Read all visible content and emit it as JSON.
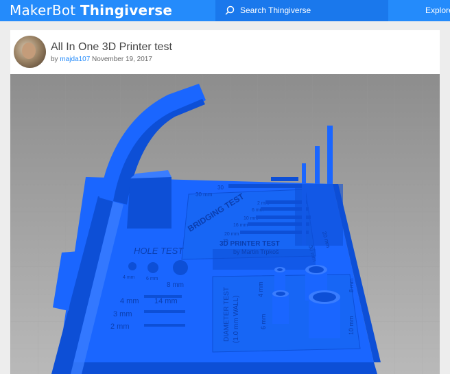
{
  "header": {
    "logo_maker": "MakerBot",
    "logo_brand": "Thingiverse",
    "search_placeholder": "Search Thingiverse",
    "search_icon": "search-icon",
    "explore_label": "Explore"
  },
  "thing": {
    "title": "All In One 3D Printer test",
    "by_prefix": "by",
    "author": "majda107",
    "date": "November 19, 2017"
  },
  "model": {
    "label_bridging": "BRIDGING TEST",
    "label_hole": "HOLE TEST",
    "label_printer": "3D PRINTER TEST",
    "label_by": "by Martin Trpkoš",
    "label_diameter": "DIAMETER TEST",
    "label_diameter_sub": "(1.0 mm WALL)",
    "hole_4": "4 mm",
    "hole_6": "6 mm",
    "hole_8": "8 mm",
    "slot_4": "4 mm",
    "slot_14": "14 mm",
    "slot_3": "3 mm",
    "slot_2": "2 mm",
    "bridge_30": "30",
    "bridge_30mm": "30 mm",
    "bridge_2": "2 mm",
    "bridge_6": "6 mm",
    "bridge_10": "10 mm",
    "bridge_16": "16 mm",
    "bridge_20": "20 mm",
    "bridge_25": "25",
    "dia_4": "4 mm",
    "dia_6": "6 mm",
    "dia_8": "8 mm",
    "dia_10": "10 mm",
    "pillar_20": "20 mm",
    "pillar_30": "30 mm",
    "colors": {
      "model": "#1a66ff",
      "model_dark": "#0d4fd6",
      "model_light": "#3a7dff"
    }
  }
}
